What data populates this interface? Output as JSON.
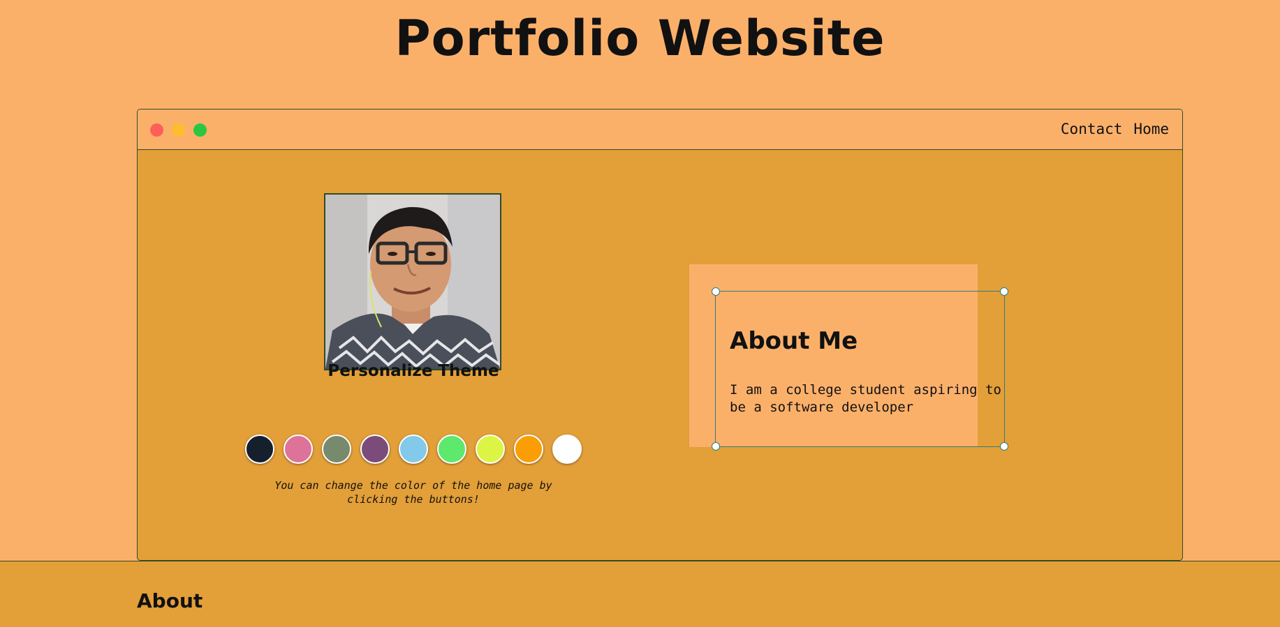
{
  "header": {
    "title": "Portfolio Website"
  },
  "window": {
    "controls": [
      {
        "name": "close-dot",
        "color": "#fe5f58"
      },
      {
        "name": "minimize-dot",
        "color": "#febc2e"
      },
      {
        "name": "maximize-dot",
        "color": "#29c840"
      }
    ],
    "nav": {
      "contact_label": "Contact",
      "home_label": "Home"
    }
  },
  "profile": {
    "photo": "profile-photo"
  },
  "theme": {
    "title": "Personalize Theme",
    "hint": "You can change the color of the home page by clicking the buttons!",
    "swatches": [
      "#16202d",
      "#de7399",
      "#788a6e",
      "#7b4c7a",
      "#83c9e9",
      "#5ee86c",
      "#dcf545",
      "#fb9e05",
      "#ffffff"
    ]
  },
  "about_card": {
    "title": "About Me",
    "text": "I am a college student aspiring to be a software developer"
  },
  "about_section": {
    "title": "About"
  },
  "colors": {
    "page_background": "#fbb06a",
    "window_background": "#e39f38",
    "border": "#2f4a2a",
    "selection": "#2e7c80"
  }
}
